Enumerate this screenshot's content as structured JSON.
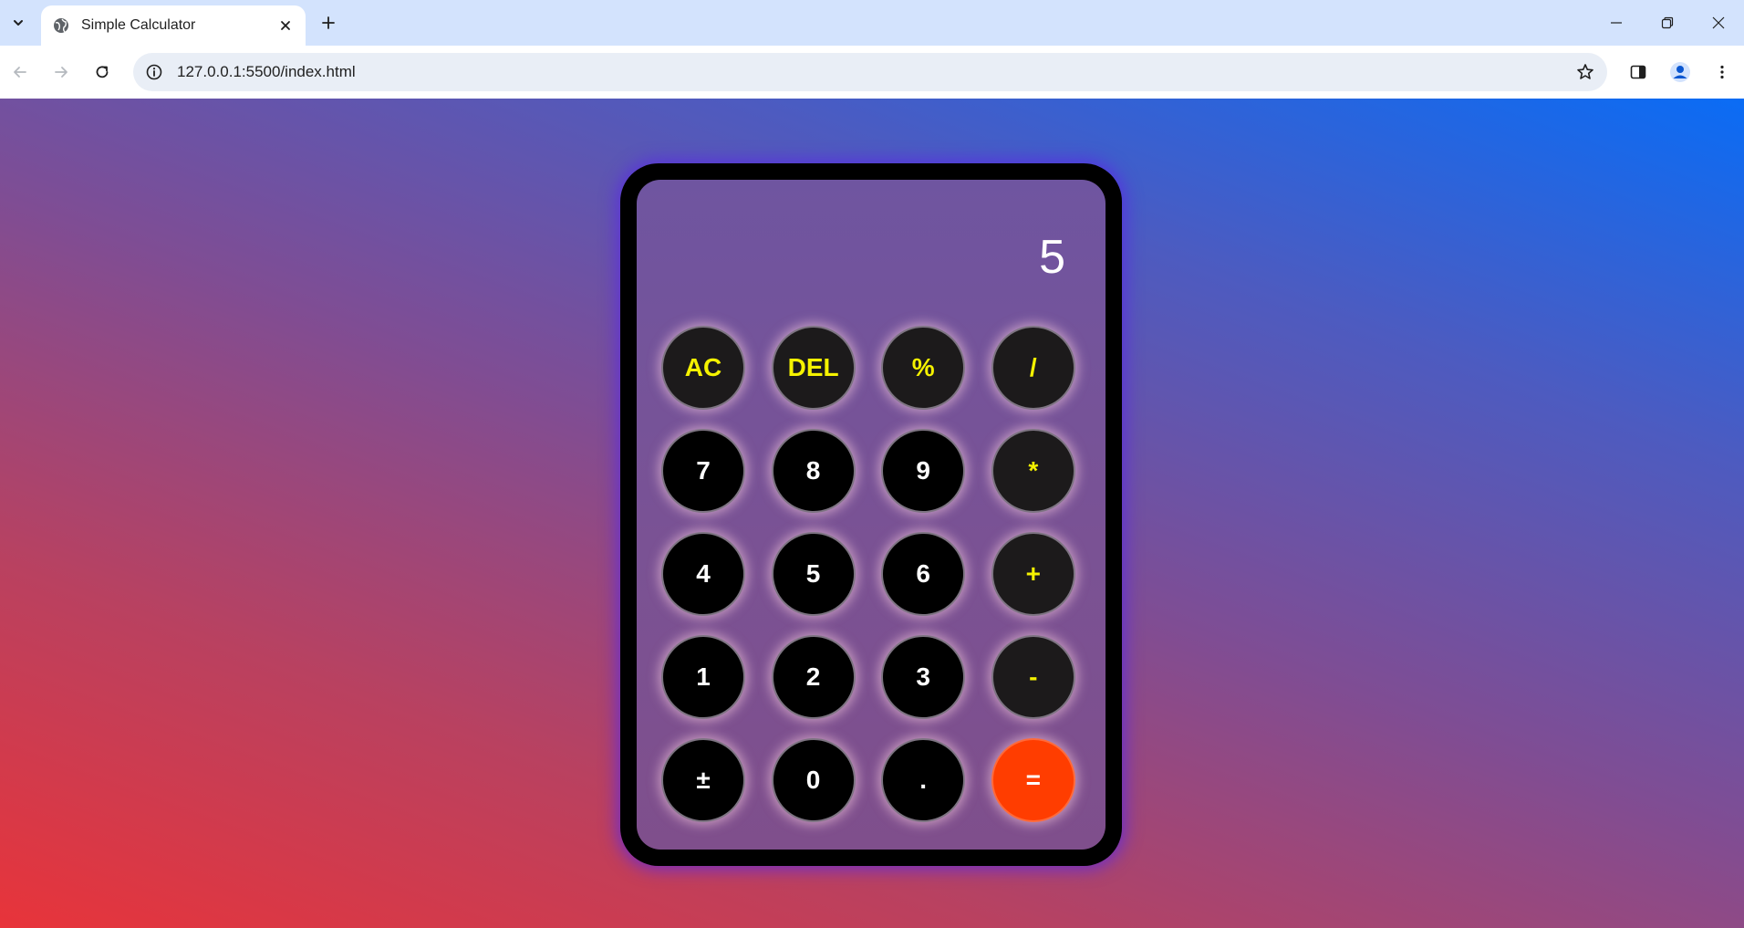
{
  "browser": {
    "tab_title": "Simple Calculator",
    "url": "127.0.0.1:5500/index.html"
  },
  "calculator": {
    "display": "5",
    "keys": [
      {
        "label": "AC",
        "kind": "op",
        "name": "ac-button"
      },
      {
        "label": "DEL",
        "kind": "op",
        "name": "del-button"
      },
      {
        "label": "%",
        "kind": "op",
        "name": "percent-button"
      },
      {
        "label": "/",
        "kind": "op",
        "name": "divide-button"
      },
      {
        "label": "7",
        "kind": "num",
        "name": "digit-7-button"
      },
      {
        "label": "8",
        "kind": "num",
        "name": "digit-8-button"
      },
      {
        "label": "9",
        "kind": "num",
        "name": "digit-9-button"
      },
      {
        "label": "*",
        "kind": "op",
        "name": "multiply-button"
      },
      {
        "label": "4",
        "kind": "num",
        "name": "digit-4-button"
      },
      {
        "label": "5",
        "kind": "num",
        "name": "digit-5-button"
      },
      {
        "label": "6",
        "kind": "num",
        "name": "digit-6-button"
      },
      {
        "label": "+",
        "kind": "op",
        "name": "add-button"
      },
      {
        "label": "1",
        "kind": "num",
        "name": "digit-1-button"
      },
      {
        "label": "2",
        "kind": "num",
        "name": "digit-2-button"
      },
      {
        "label": "3",
        "kind": "num",
        "name": "digit-3-button"
      },
      {
        "label": "-",
        "kind": "op",
        "name": "subtract-button"
      },
      {
        "label": "±",
        "kind": "num",
        "name": "plus-minus-button"
      },
      {
        "label": "0",
        "kind": "num",
        "name": "digit-0-button"
      },
      {
        "label": ".",
        "kind": "num",
        "name": "decimal-button"
      },
      {
        "label": "=",
        "kind": "eq",
        "name": "equals-button"
      }
    ]
  },
  "colors": {
    "operator_text": "#f5f200",
    "equals_background": "#ff3d00",
    "frame": "#000000"
  }
}
